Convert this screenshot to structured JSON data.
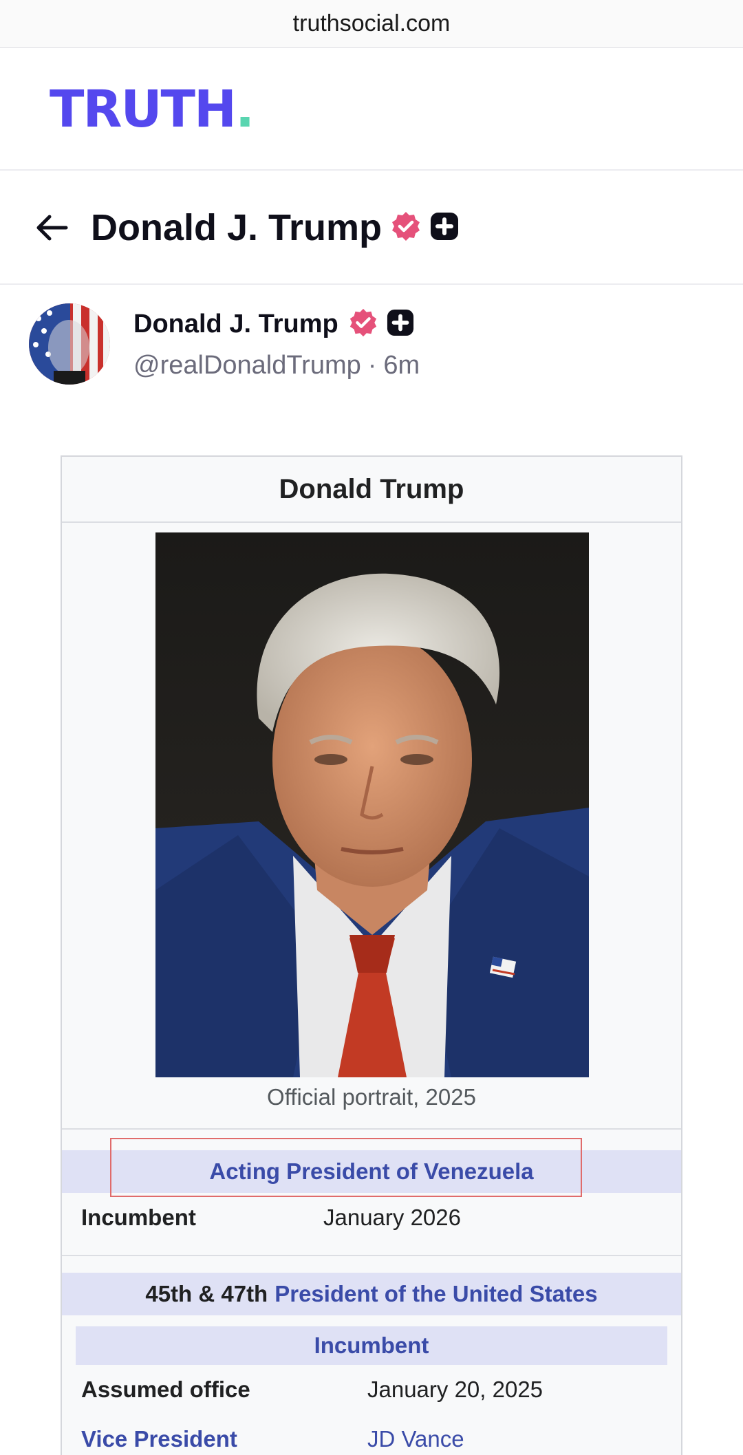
{
  "browser": {
    "url": "truthsocial.com"
  },
  "brand": {
    "name": "TRUTH",
    "dot": "."
  },
  "profile_bar": {
    "title": "Donald J. Trump"
  },
  "post": {
    "author_name": "Donald J. Trump",
    "handle": "@realDonaldTrump",
    "separator": "·",
    "time": "6m"
  },
  "infobox": {
    "title": "Donald Trump",
    "caption": "Official portrait, 2025",
    "section1": {
      "heading": "Acting President of Venezuela"
    },
    "row1": {
      "label": "Incumbent",
      "value": "January 2026"
    },
    "section2": {
      "prefix": "45th & 47th",
      "link": "President of the United States"
    },
    "subheading": "Incumbent",
    "row2": {
      "label": "Assumed office",
      "value": "January 20, 2025"
    },
    "row3": {
      "label": "Vice President",
      "value": "JD Vance"
    }
  },
  "colors": {
    "brand": "#5448ee",
    "brand_dot": "#59d5b0",
    "verified_badge": "#e5517a",
    "link": "#3a4ba8",
    "section_bg": "#dfe1f5",
    "highlight": "#e06b6b"
  },
  "icons": [
    "back-arrow-icon",
    "verified-badge-icon",
    "plus-badge-icon"
  ]
}
